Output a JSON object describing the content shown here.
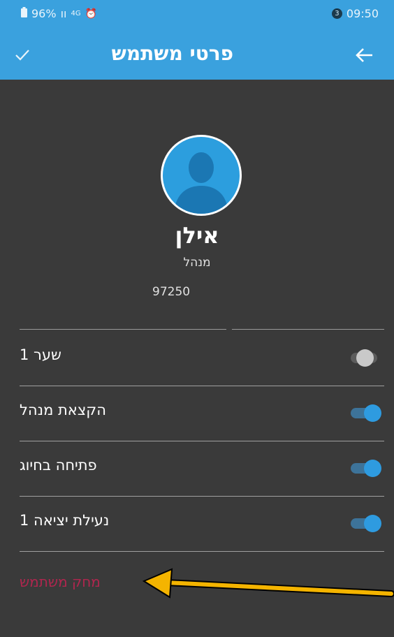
{
  "status_bar": {
    "battery": "96%",
    "signal": "ıı",
    "network": "4G",
    "alarm": "⏰",
    "notification_count": "3",
    "time": "09:50"
  },
  "app_bar": {
    "title": "פרטי משתמש"
  },
  "user": {
    "name": "אילן",
    "role": "מנהל",
    "phone": "97250"
  },
  "settings": [
    {
      "label": "שער 1",
      "enabled": false
    },
    {
      "label": "הקצאת מנהל",
      "enabled": true
    },
    {
      "label": "פתיחה בחיוג",
      "enabled": true
    },
    {
      "label": "נעילת יציאה 1",
      "enabled": true
    }
  ],
  "delete_user_label": "מחק משתמש",
  "colors": {
    "app_bar": "#3aa1de",
    "background": "#3a3a3a",
    "toggle_on": "#2e9be0",
    "delete_text": "#b0264e",
    "annotation_arrow": "#f4b400"
  }
}
